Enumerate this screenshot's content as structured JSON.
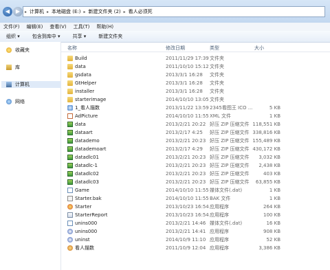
{
  "address": {
    "segments": [
      "计算机",
      "本地磁盘 (E:)",
      "新建文件夹 (2)",
      "看人必须死"
    ]
  },
  "menu": [
    "文件(F)",
    "编辑(E)",
    "查看(V)",
    "工具(T)",
    "帮助(H)"
  ],
  "toolbar": [
    "组织 ▾",
    "包含到库中 ▾",
    "共享 ▾",
    "新建文件夹"
  ],
  "sidebar": [
    {
      "label": "收藏夹",
      "icon": "star-icon"
    },
    {
      "label": "库",
      "icon": "library-icon"
    },
    {
      "label": "计算机",
      "icon": "computer-icon"
    },
    {
      "label": "网络",
      "icon": "network-icon"
    }
  ],
  "columns": {
    "name": "名称",
    "date": "修改日期",
    "type": "类型",
    "size": "大小"
  },
  "files": [
    {
      "name": "Build",
      "date": "2011/11/29 17:39",
      "type": "文件夹",
      "size": "",
      "icon": "folder"
    },
    {
      "name": "data",
      "date": "2011/10/10 15:12",
      "type": "文件夹",
      "size": "",
      "icon": "folder"
    },
    {
      "name": "gsdata",
      "date": "2013/3/1 16:28",
      "type": "文件夹",
      "size": "",
      "icon": "folder"
    },
    {
      "name": "GtHelper",
      "date": "2013/3/1 16:28",
      "type": "文件夹",
      "size": "",
      "icon": "folder"
    },
    {
      "name": "installer",
      "date": "2013/3/1 16:28",
      "type": "文件夹",
      "size": "",
      "icon": "folder"
    },
    {
      "name": "starterimage",
      "date": "2014/10/10 13:05",
      "type": "文件夹",
      "size": "",
      "icon": "folder"
    },
    {
      "name": "1_看人描数",
      "date": "2013/11/22 13:59",
      "type": "2345看图王 ICO ...",
      "size": "5 KB",
      "icon": "ico"
    },
    {
      "name": "AdPicture",
      "date": "2014/10/10 11:55",
      "type": "XML 文件",
      "size": "1 KB",
      "icon": "xml"
    },
    {
      "name": "data",
      "date": "2013/2/21 20:22",
      "type": "好压 ZIP 压缩文件",
      "size": "118,551 KB",
      "icon": "zip"
    },
    {
      "name": "dataart",
      "date": "2013/2/17 4:25",
      "type": "好压 ZIP 压缩文件",
      "size": "338,816 KB",
      "icon": "zip"
    },
    {
      "name": "datademo",
      "date": "2013/2/21 20:23",
      "type": "好压 ZIP 压缩文件",
      "size": "155,489 KB",
      "icon": "zip"
    },
    {
      "name": "datademoart",
      "date": "2013/2/17 4:29",
      "type": "好压 ZIP 压缩文件",
      "size": "430,172 KB",
      "icon": "zip"
    },
    {
      "name": "datadlc01",
      "date": "2013/2/21 20:23",
      "type": "好压 ZIP 压缩文件",
      "size": "3,032 KB",
      "icon": "zip"
    },
    {
      "name": "datadlc-1",
      "date": "2013/2/21 20:23",
      "type": "好压 ZIP 压缩文件",
      "size": "2,438 KB",
      "icon": "zip"
    },
    {
      "name": "datadlc02",
      "date": "2013/2/21 20:23",
      "type": "好压 ZIP 压缩文件",
      "size": "403 KB",
      "icon": "zip"
    },
    {
      "name": "datadlc03",
      "date": "2013/2/21 20:23",
      "type": "好压 ZIP 压缩文件",
      "size": "63,855 KB",
      "icon": "zip"
    },
    {
      "name": "Game",
      "date": "2014/10/10 11:55",
      "type": "媒体文件(.dat)",
      "size": "1 KB",
      "icon": "dat"
    },
    {
      "name": "Starter.bak",
      "date": "2014/10/10 11:55",
      "type": "BAK 文件",
      "size": "1 KB",
      "icon": "file"
    },
    {
      "name": "Starter",
      "date": "2013/10/23 16:54",
      "type": "应用程序",
      "size": "264 KB",
      "icon": "star"
    },
    {
      "name": "StarterReport",
      "date": "2013/10/23 16:54",
      "type": "应用程序",
      "size": "100 KB",
      "icon": "exe"
    },
    {
      "name": "unins000",
      "date": "2013/2/21 14:46",
      "type": "媒体文件(.dat)",
      "size": "16 KB",
      "icon": "dat"
    },
    {
      "name": "unins000",
      "date": "2013/2/21 14:41",
      "type": "应用程序",
      "size": "908 KB",
      "icon": "uni"
    },
    {
      "name": "uninst",
      "date": "2014/10/9 11:10",
      "type": "应用程序",
      "size": "52 KB",
      "icon": "uni"
    },
    {
      "name": "看人描数",
      "date": "2011/10/9 12:04",
      "type": "应用程序",
      "size": "3,386 KB",
      "icon": "app"
    }
  ]
}
